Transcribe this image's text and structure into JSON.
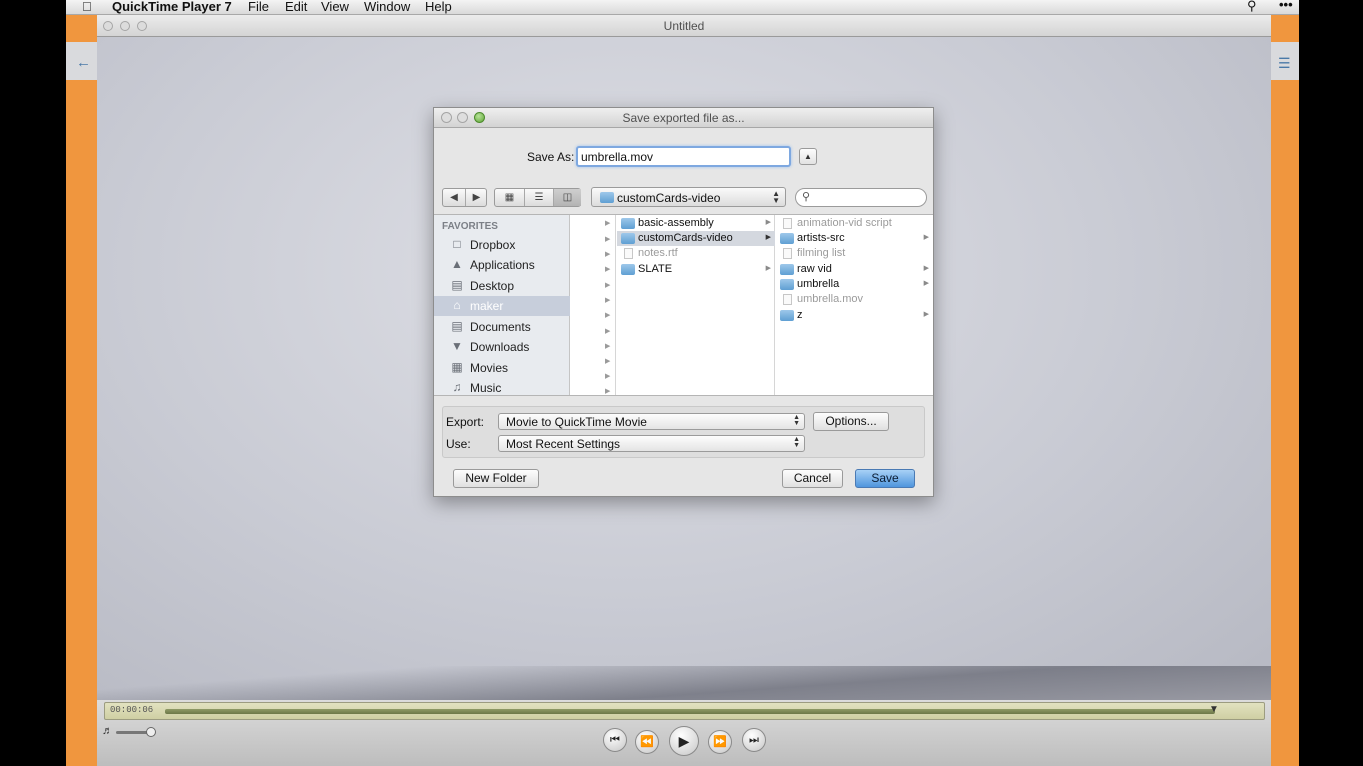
{
  "menubar": {
    "app_name": "QuickTime Player 7",
    "menus": [
      "File",
      "Edit",
      "View",
      "Window",
      "Help"
    ]
  },
  "window": {
    "title": "Untitled"
  },
  "player": {
    "timecode": "00:00:06"
  },
  "dialog": {
    "title": "Save exported file as...",
    "save_as_label": "Save As:",
    "save_as_value": "umbrella.mov",
    "path_popup": "customCards-video",
    "search_placeholder": "",
    "sidebar": {
      "header": "FAVORITES",
      "items": [
        {
          "label": "Dropbox",
          "icon": "folder-icon",
          "selected": false
        },
        {
          "label": "Applications",
          "icon": "applications-icon",
          "selected": false
        },
        {
          "label": "Desktop",
          "icon": "desktop-icon",
          "selected": false
        },
        {
          "label": "maker",
          "icon": "home-icon",
          "selected": true
        },
        {
          "label": "Documents",
          "icon": "documents-icon",
          "selected": false
        },
        {
          "label": "Downloads",
          "icon": "downloads-icon",
          "selected": false
        },
        {
          "label": "Movies",
          "icon": "movies-icon",
          "selected": false
        },
        {
          "label": "Music",
          "icon": "music-icon",
          "selected": false
        }
      ]
    },
    "column2": [
      {
        "name": "basic-assembly",
        "kind": "folder",
        "selected": false,
        "dim": false
      },
      {
        "name": "customCards-video",
        "kind": "folder",
        "selected": true,
        "dim": false
      },
      {
        "name": "notes.rtf",
        "kind": "file",
        "selected": false,
        "dim": true
      },
      {
        "name": "SLATE",
        "kind": "folder",
        "selected": false,
        "dim": false
      }
    ],
    "column3": [
      {
        "name": "animation-vid script",
        "kind": "file",
        "dim": true
      },
      {
        "name": "artists-src",
        "kind": "folder",
        "dim": false
      },
      {
        "name": "filming list",
        "kind": "file",
        "dim": true
      },
      {
        "name": "raw vid",
        "kind": "folder",
        "dim": false
      },
      {
        "name": "umbrella",
        "kind": "folder",
        "dim": false
      },
      {
        "name": "umbrella.mov",
        "kind": "file",
        "dim": true
      },
      {
        "name": "z",
        "kind": "folder",
        "dim": false
      }
    ],
    "export_label": "Export:",
    "export_value": "Movie to QuickTime Movie",
    "options_button": "Options...",
    "use_label": "Use:",
    "use_value": "Most Recent Settings",
    "new_folder_button": "New Folder",
    "cancel_button": "Cancel",
    "save_button": "Save"
  },
  "colors": {
    "accent_strip": "#f0963e",
    "default_button": "#4f95dd",
    "selection": "#c7cedb"
  }
}
